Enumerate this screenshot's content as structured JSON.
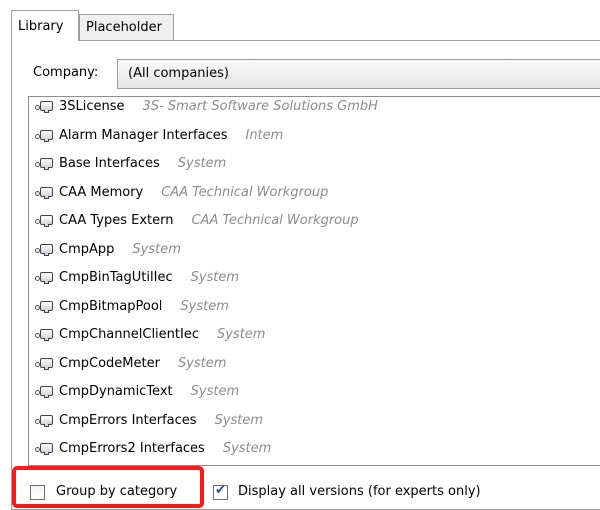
{
  "tabs": [
    {
      "label": "Library",
      "active": true
    },
    {
      "label": "Placeholder",
      "active": false
    }
  ],
  "company": {
    "label": "Company:",
    "value": "(All companies)"
  },
  "libraries": [
    {
      "name": "3SLicense",
      "vendor": "3S- Smart Software Solutions GmbH"
    },
    {
      "name": "Alarm Manager Interfaces",
      "vendor": "Intem"
    },
    {
      "name": "Base Interfaces",
      "vendor": "System"
    },
    {
      "name": "CAA Memory",
      "vendor": "CAA Technical Workgroup"
    },
    {
      "name": "CAA Types Extern",
      "vendor": "CAA Technical Workgroup"
    },
    {
      "name": "CmpApp",
      "vendor": "System"
    },
    {
      "name": "CmpBinTagUtilIec",
      "vendor": "System"
    },
    {
      "name": "CmpBitmapPool",
      "vendor": "System"
    },
    {
      "name": "CmpChannelClientIec",
      "vendor": "System"
    },
    {
      "name": "CmpCodeMeter",
      "vendor": "System"
    },
    {
      "name": "CmpDynamicText",
      "vendor": "System"
    },
    {
      "name": "CmpErrors Interfaces",
      "vendor": "System"
    },
    {
      "name": "CmpErrors2 Interfaces",
      "vendor": "System"
    }
  ],
  "footer": {
    "group_by_category": {
      "label": "Group by category",
      "checked": false
    },
    "display_all_versions": {
      "label": "Display all versions (for experts only)",
      "checked": true
    }
  },
  "colors": {
    "highlight": "#ff1a1a",
    "vendor_text": "#8c8c8c",
    "border": "#a0a0a0"
  },
  "icons": {
    "library_item": "library-module-icon",
    "checkmark": "checkmark-icon"
  }
}
